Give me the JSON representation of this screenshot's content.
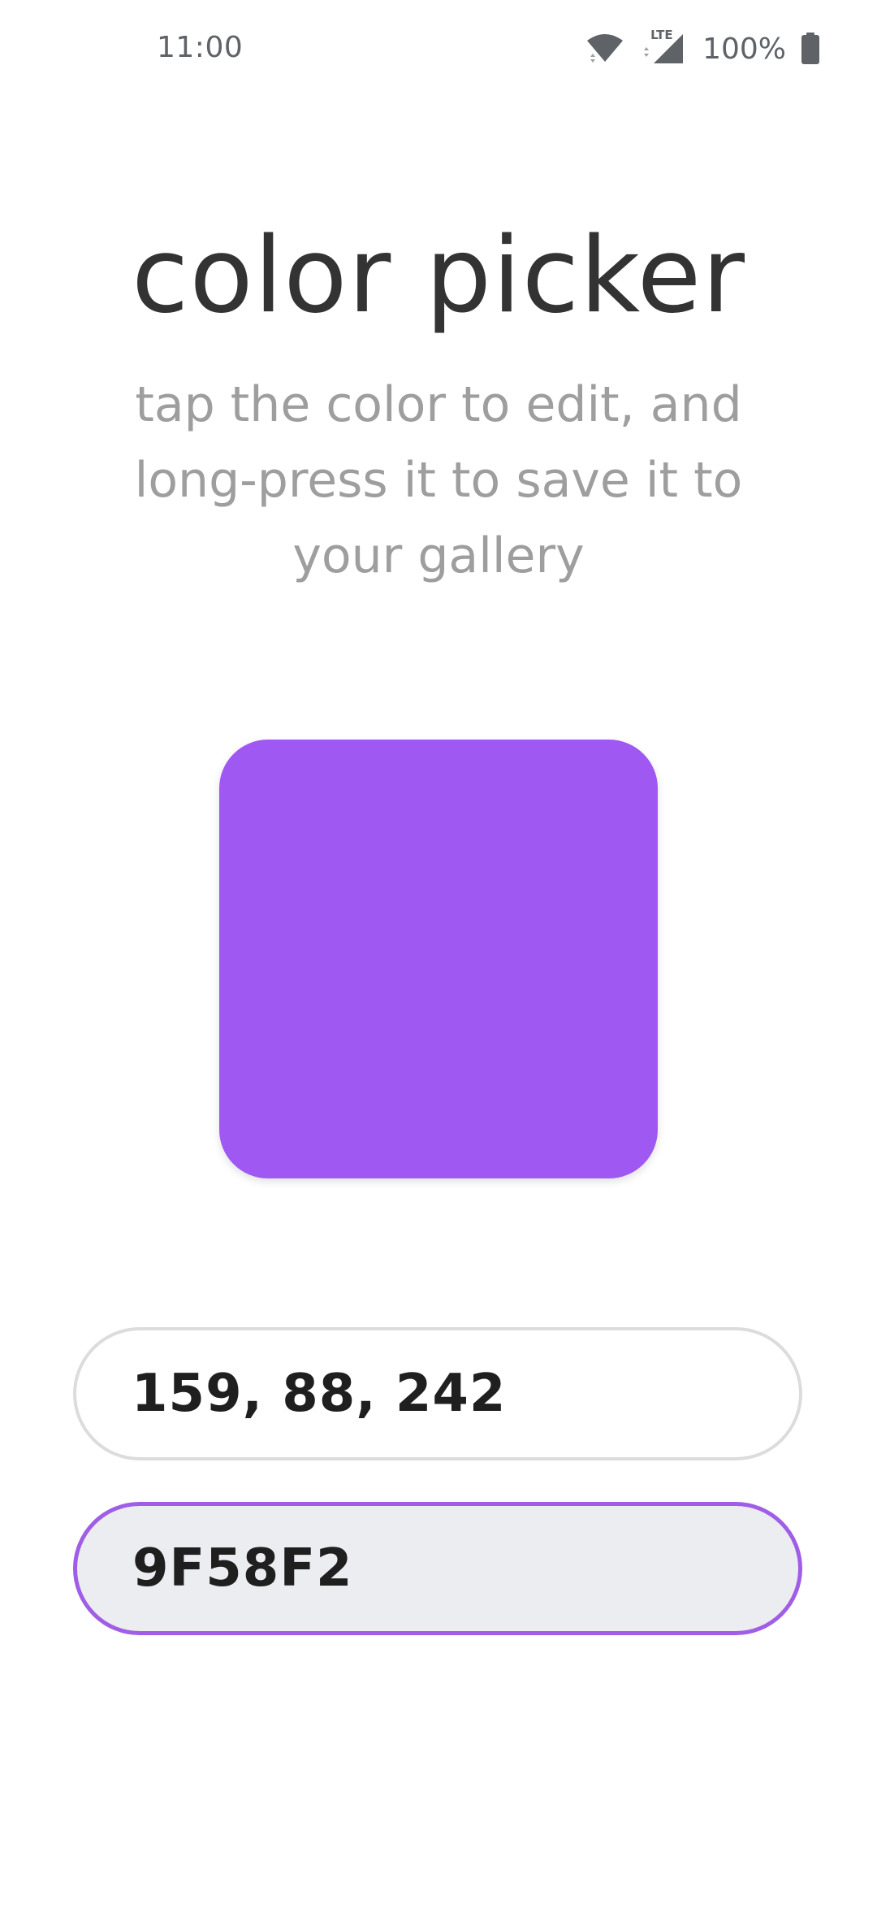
{
  "status_bar": {
    "time": "11:00",
    "network_label": "LTE",
    "battery_percent": "100%",
    "icons": [
      "wifi-icon",
      "cellular-signal-icon",
      "battery-icon"
    ]
  },
  "header": {
    "title": "color picker",
    "subtitle": "tap the color to edit, and long-press it to save it to your gallery"
  },
  "swatch": {
    "color": "#9F58F2"
  },
  "inputs": {
    "rgb_value": "159, 88, 242",
    "hex_value": "9F58F2"
  },
  "colors": {
    "accent": "#9F58F2",
    "focused_border": "#A05EE6",
    "title_text": "#333333",
    "subtitle_text": "#9E9E9E"
  }
}
